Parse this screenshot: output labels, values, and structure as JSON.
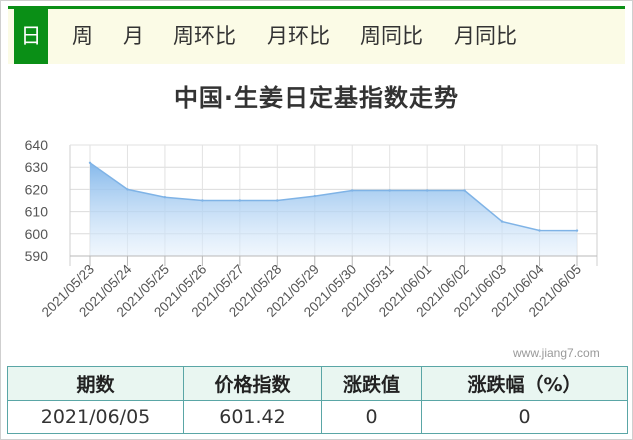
{
  "tabs": [
    {
      "label": "日",
      "active": true
    },
    {
      "label": "周",
      "active": false
    },
    {
      "label": "月",
      "active": false
    },
    {
      "label": "周环比",
      "active": false
    },
    {
      "label": "月环比",
      "active": false
    },
    {
      "label": "周同比",
      "active": false
    },
    {
      "label": "月同比",
      "active": false
    }
  ],
  "colors": {
    "accent": "#0a8f16",
    "tab_bg": "#fbfbe6",
    "line": "#7fb3e6",
    "fill_top": "#7fb5ea",
    "table_border": "#5aa6a6",
    "table_head_bg": "#e9f6f1"
  },
  "chart_data": {
    "type": "area",
    "title": "中国·生姜日定基指数走势",
    "xlabel": "",
    "ylabel": "",
    "categories": [
      "2021/05/23",
      "2021/05/24",
      "2021/05/25",
      "2021/05/26",
      "2021/05/27",
      "2021/05/28",
      "2021/05/29",
      "2021/05/30",
      "2021/05/31",
      "2021/06/01",
      "2021/06/02",
      "2021/06/03",
      "2021/06/04",
      "2021/06/05"
    ],
    "values": [
      632,
      620,
      616.5,
      615,
      615,
      615,
      617,
      619.5,
      619.5,
      619.5,
      619.5,
      605.5,
      601.5,
      601.42
    ],
    "yticks": [
      590,
      600,
      610,
      620,
      630,
      640
    ],
    "ylim": [
      590,
      640
    ],
    "grid": true,
    "legend": "none"
  },
  "watermark": "www.jiang7.com",
  "table": {
    "headers": [
      "期数",
      "价格指数",
      "涨跌值",
      "涨跌幅（%）"
    ],
    "row": [
      "2021/06/05",
      "601.42",
      "0",
      "0"
    ]
  }
}
